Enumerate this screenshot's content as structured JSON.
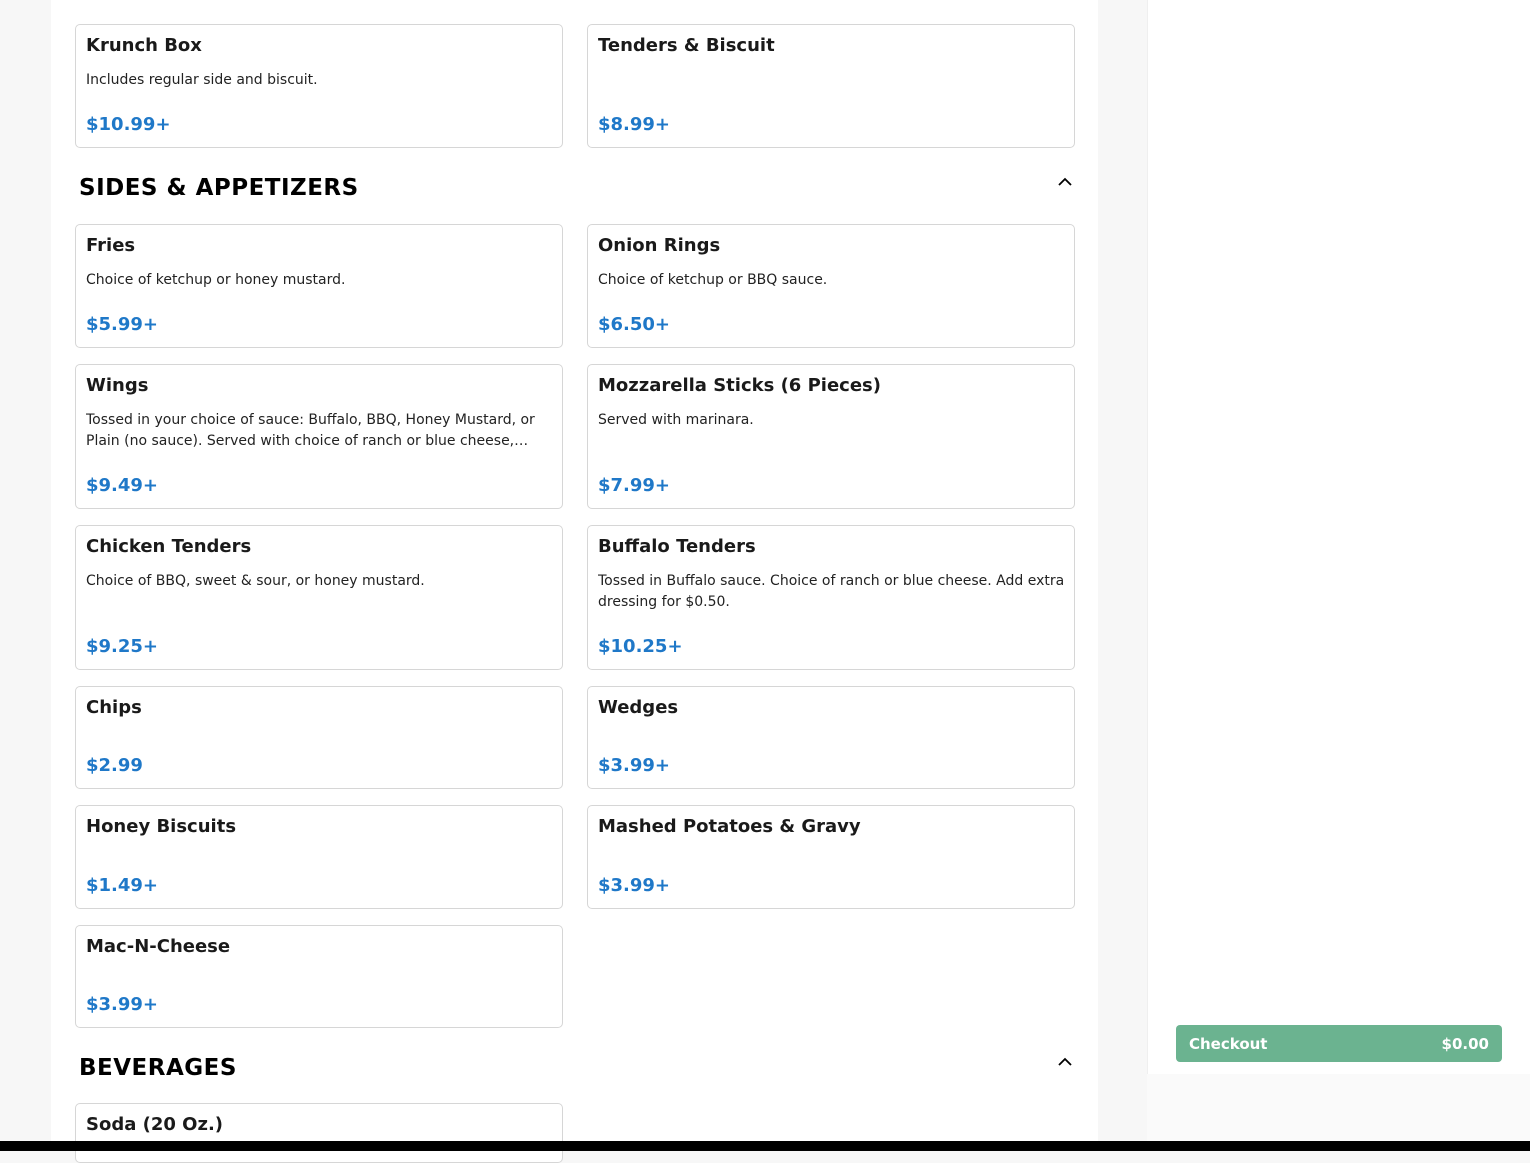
{
  "sections": {
    "top_items": [
      {
        "name": "Krunch Box",
        "description": "Includes regular side and biscuit.",
        "price": "$10.99+"
      },
      {
        "name": "Tenders & Biscuit",
        "description": "",
        "price": "$8.99+"
      }
    ],
    "sides": {
      "title": "SIDES & APPETIZERS",
      "toggle_icon": "chevron-up-icon",
      "items": [
        {
          "name": "Fries",
          "description": "Choice of ketchup or honey mustard.",
          "price": "$5.99+"
        },
        {
          "name": "Onion Rings",
          "description": "Choice of ketchup or BBQ sauce.",
          "price": "$6.50+"
        },
        {
          "name": "Wings",
          "description": "Tossed in your choice of sauce: Buffalo, BBQ, Honey Mustard, or Plain (no sauce). Served with choice of ranch or blue cheese, additional dressing available.",
          "price": "$9.49+"
        },
        {
          "name": "Mozzarella Sticks (6 Pieces)",
          "description": "Served with marinara.",
          "price": "$7.99+"
        },
        {
          "name": "Chicken Tenders",
          "description": "Choice of BBQ, sweet & sour, or honey mustard.",
          "price": "$9.25+"
        },
        {
          "name": "Buffalo Tenders",
          "description": "Tossed in Buffalo sauce. Choice of ranch or blue cheese. Add extra dressing for $0.50.",
          "price": "$10.25+"
        },
        {
          "name": "Chips",
          "description": "",
          "price": "$2.99"
        },
        {
          "name": "Wedges",
          "description": "",
          "price": "$3.99+"
        },
        {
          "name": "Honey Biscuits",
          "description": "",
          "price": "$1.49+"
        },
        {
          "name": "Mashed Potatoes & Gravy",
          "description": "",
          "price": "$3.99+"
        },
        {
          "name": "Mac-N-Cheese",
          "description": "",
          "price": "$3.99+"
        }
      ]
    },
    "beverages": {
      "title": "BEVERAGES",
      "toggle_icon": "chevron-up-icon",
      "items": [
        {
          "name": "Soda (20 Oz.)",
          "description": "",
          "price": ""
        }
      ]
    }
  },
  "cart": {
    "checkout_label": "Checkout",
    "total": "$0.00"
  },
  "colors": {
    "price": "#1f78c8",
    "checkout": "#6bb390"
  }
}
